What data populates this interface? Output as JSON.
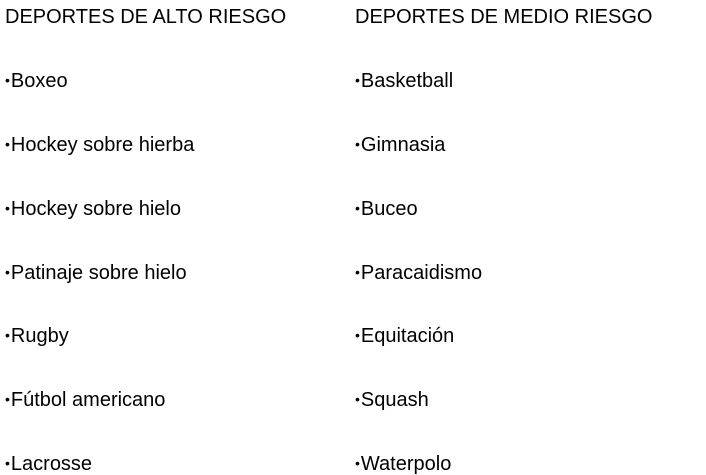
{
  "high_risk": {
    "title": "DEPORTES DE ALTO RIESGO",
    "items": [
      "Boxeo",
      "Hockey sobre hierba",
      "Hockey sobre hielo",
      "Patinaje sobre hielo",
      "Rugby",
      "Fútbol americano",
      "Lacrosse"
    ]
  },
  "medium_risk": {
    "title": "DEPORTES DE MEDIO RIESGO",
    "items": [
      "Basketball",
      "Gimnasia",
      "Buceo",
      "Paracaidismo",
      "Equitación",
      "Squash",
      "Waterpolo"
    ]
  },
  "bullet": "•"
}
